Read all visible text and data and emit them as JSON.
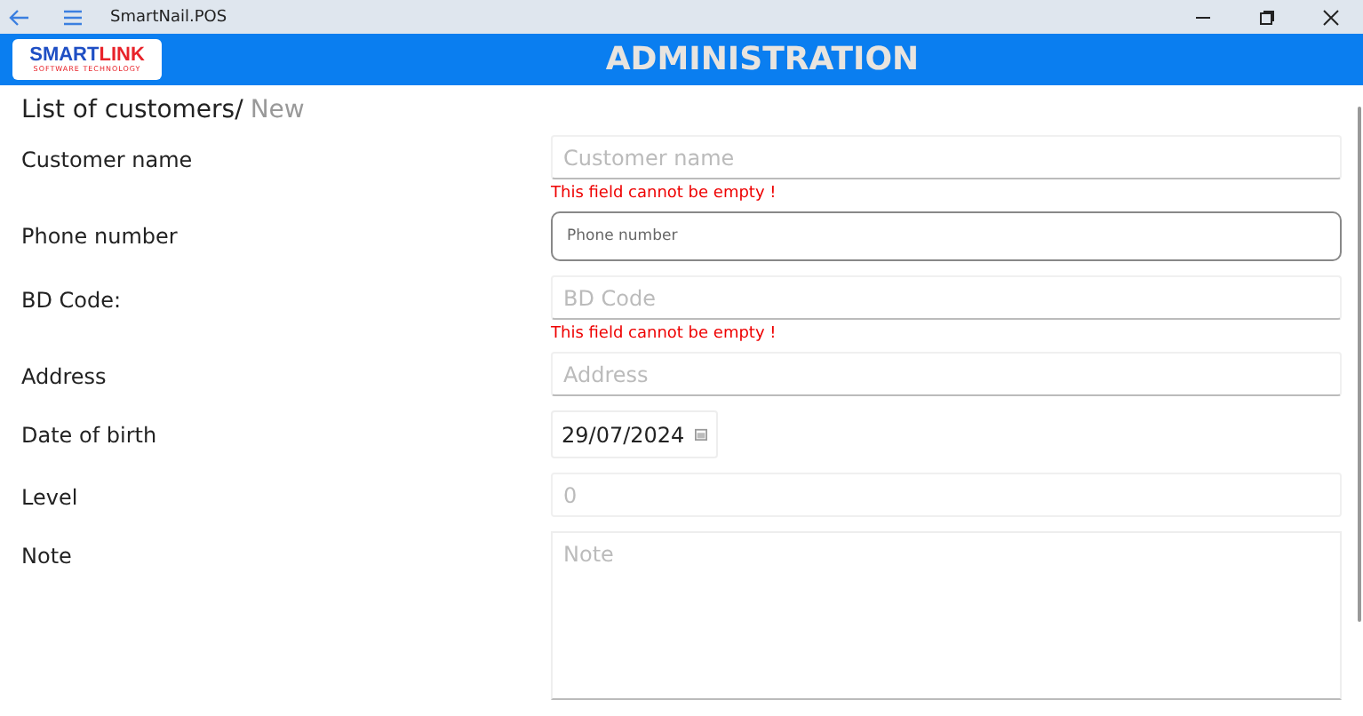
{
  "window": {
    "title": "SmartNail.POS"
  },
  "logo": {
    "part_1": "SMART",
    "part_2": "LINK",
    "tagline": "SOFTWARE TECHNOLOGY"
  },
  "header": {
    "title": "ADMINISTRATION"
  },
  "breadcrumb": {
    "parent": "List of customers/",
    "current": "New"
  },
  "fields": [
    {
      "label": "Customer name",
      "kind": "underline",
      "placeholder": "Customer name",
      "error": "This field cannot be empty !"
    },
    {
      "label": "Phone number",
      "kind": "outlined",
      "placeholder": "Phone number"
    },
    {
      "label": "BD Code:",
      "kind": "underline",
      "placeholder": "BD Code",
      "error": "This field cannot be empty !"
    },
    {
      "label": "Address",
      "kind": "underline",
      "placeholder": "Address"
    },
    {
      "label": "Date of birth",
      "kind": "date",
      "value": "29/07/2024"
    },
    {
      "label": "Level",
      "kind": "number",
      "placeholder": "0"
    },
    {
      "label": "Note",
      "kind": "textarea",
      "placeholder": "Note"
    }
  ]
}
